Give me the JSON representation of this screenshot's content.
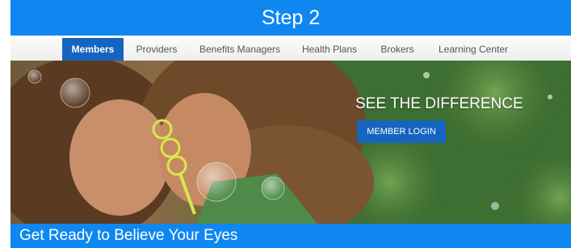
{
  "step_banner": {
    "title": "Step 2"
  },
  "nav": {
    "items": [
      {
        "label": "Members",
        "active": true
      },
      {
        "label": "Providers",
        "active": false
      },
      {
        "label": "Benefits Managers",
        "active": false
      },
      {
        "label": "Health Plans",
        "active": false
      },
      {
        "label": "Brokers",
        "active": false
      },
      {
        "label": "Learning Center",
        "active": false
      }
    ]
  },
  "hero": {
    "heading": "SEE THE DIFFERENCE",
    "login_button": "MEMBER LOGIN",
    "image_subject": "two girls blowing bubbles"
  },
  "tagline": {
    "text": "Get Ready to Believe Your Eyes"
  },
  "colors": {
    "brand_blue": "#0f87f0",
    "active_tab": "#1565c0",
    "button_blue": "#1565c0"
  }
}
